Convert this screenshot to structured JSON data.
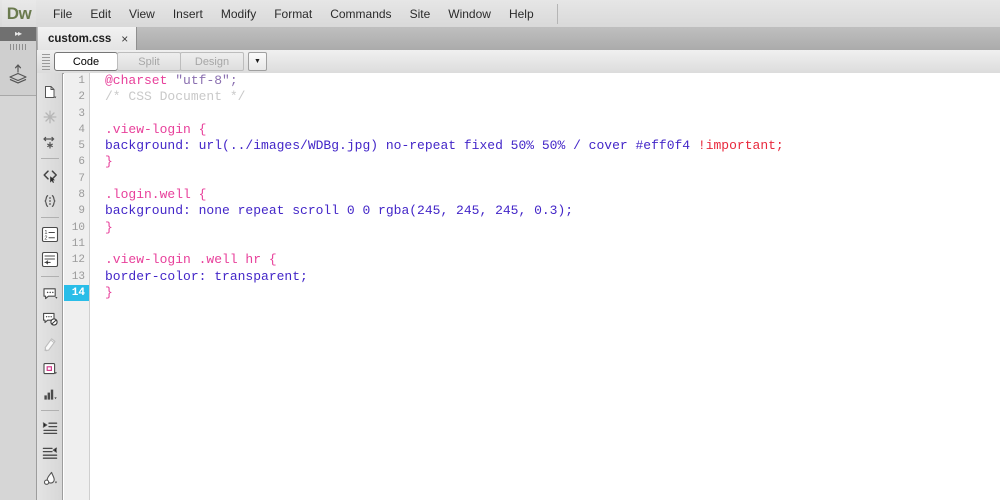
{
  "app": {
    "name": "Dw",
    "logo_color": "#6a7a4e"
  },
  "menubar": {
    "items": [
      {
        "label": "File"
      },
      {
        "label": "Edit"
      },
      {
        "label": "View"
      },
      {
        "label": "Insert"
      },
      {
        "label": "Modify"
      },
      {
        "label": "Format"
      },
      {
        "label": "Commands"
      },
      {
        "label": "Site"
      },
      {
        "label": "Window"
      },
      {
        "label": "Help"
      }
    ]
  },
  "left_panel": {
    "expand_icon": "double-chevron-right-icon",
    "grip": "panel-grip",
    "insert_icon": "layers-stack-icon"
  },
  "tabs": [
    {
      "label": "custom.css",
      "close": "×",
      "active": true
    }
  ],
  "view_toolbar": {
    "buttons": [
      {
        "label": "Code",
        "state": "active"
      },
      {
        "label": "Split",
        "state": "disabled"
      },
      {
        "label": "Design",
        "state": "disabled"
      }
    ],
    "caret": "▼"
  },
  "coding_toolbar": {
    "buttons": [
      {
        "name": "open-documents-icon"
      },
      {
        "name": "file-management-icon"
      },
      {
        "name": "preview-browser-icon"
      },
      {
        "name": "code-navigation-icon"
      },
      {
        "name": "collapse-full-tag-icon"
      },
      {
        "name": "line-numbers-icon"
      },
      {
        "name": "word-wrap-icon"
      },
      {
        "name": "apply-comment-icon"
      },
      {
        "name": "remove-comment-icon"
      },
      {
        "name": "highlight-invalid-code-icon"
      },
      {
        "name": "syntax-error-alerts-icon"
      },
      {
        "name": "recent-snippets-icon"
      },
      {
        "name": "indent-code-icon"
      },
      {
        "name": "outdent-code-icon"
      },
      {
        "name": "format-source-code-icon"
      }
    ]
  },
  "editor": {
    "current_line": 14,
    "current_line_highlight": "#29bde8",
    "lines": [
      {
        "n": 1,
        "segments": [
          {
            "t": "@charset",
            "c": "t-at"
          },
          {
            "t": " ",
            "c": ""
          },
          {
            "t": "\"utf-8\";",
            "c": "t-str"
          }
        ]
      },
      {
        "n": 2,
        "segments": [
          {
            "t": "/* CSS Document */",
            "c": "t-cmt"
          }
        ]
      },
      {
        "n": 3,
        "segments": []
      },
      {
        "n": 4,
        "segments": [
          {
            "t": ".view-login {",
            "c": "t-sel"
          }
        ]
      },
      {
        "n": 5,
        "segments": [
          {
            "t": "background: url(../images/WDBg.jpg) no-repeat fixed 50% 50% / cover #eff0f4 ",
            "c": "t-prop"
          },
          {
            "t": "!important;",
            "c": "t-imp"
          }
        ]
      },
      {
        "n": 6,
        "segments": [
          {
            "t": "}",
            "c": "t-brace"
          }
        ]
      },
      {
        "n": 7,
        "segments": []
      },
      {
        "n": 8,
        "segments": [
          {
            "t": ".login.well {",
            "c": "t-sel"
          }
        ]
      },
      {
        "n": 9,
        "segments": [
          {
            "t": "background: none repeat scroll 0 0 rgba(245, 245, 245, 0.3);",
            "c": "t-prop"
          }
        ]
      },
      {
        "n": 10,
        "segments": [
          {
            "t": "}",
            "c": "t-brace"
          }
        ]
      },
      {
        "n": 11,
        "segments": []
      },
      {
        "n": 12,
        "segments": [
          {
            "t": ".view-login .well hr {",
            "c": "t-sel"
          }
        ]
      },
      {
        "n": 13,
        "segments": [
          {
            "t": "border-color: transparent;",
            "c": "t-prop"
          }
        ]
      },
      {
        "n": 14,
        "segments": [
          {
            "t": "}",
            "c": "t-brace"
          }
        ]
      }
    ]
  },
  "colors": {
    "selector": "#e8409b",
    "property": "#4326c8",
    "comment": "#c9c9c9",
    "important": "#e8283c",
    "string": "#8a6fb0",
    "gutter_bg": "#efefef",
    "code_bg": "#ffffff"
  }
}
